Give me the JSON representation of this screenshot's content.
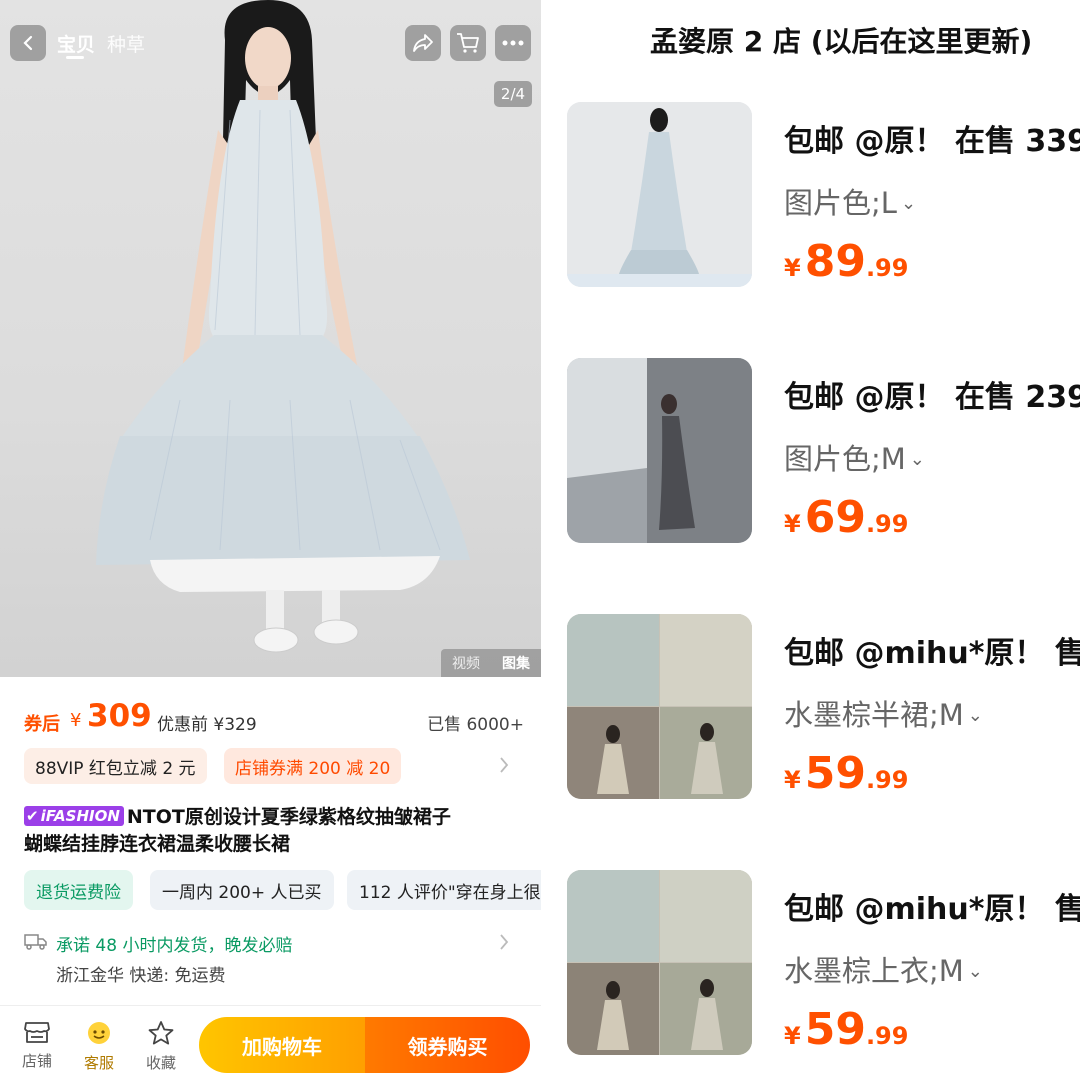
{
  "product_page": {
    "top_tabs": [
      "宝贝",
      "种草"
    ],
    "page_indicator": "2/4",
    "media_switch": [
      "视频",
      "图集"
    ],
    "price": {
      "after_label": "券后",
      "currency": "¥",
      "amount": "309",
      "before_label": "优惠前 ¥329",
      "sold": "已售 6000+"
    },
    "promos": {
      "vip": "88VIP 红包立减 2 元",
      "coupon": "店铺券满 200 减 20"
    },
    "badge": "iFASHION",
    "title_line1": "NTOT原创设计夏季绿紫格纹抽皱裙子",
    "title_line2": "蝴蝶结挂脖连衣裙温柔收腰长裙",
    "tags": {
      "return": "退货运费险",
      "bought": "一周内 200+ 人已买",
      "reviews": "112 人评价\"穿在身上很"
    },
    "shipping": {
      "promise": "承诺 48 小时内发货，晚发必赔",
      "origin": "浙江金华  快递:  免运费"
    },
    "bottom_nav": {
      "shop": "店铺",
      "service": "客服",
      "favorite": "收藏"
    },
    "add_to_cart": "加购物车",
    "buy_now": "领券购买",
    "colors": {
      "accent": "#ff5000",
      "green": "#0a9a63",
      "badge_purple": "#9b3fe8"
    }
  },
  "shop_list": {
    "shop_name": "孟婆原 2 店 (以后在这里更新)",
    "items": [
      {
        "title": "包邮 @原！ 在售 339",
        "spec": "图片色;L",
        "currency": "¥",
        "price_int": "89",
        "price_dec": ".99"
      },
      {
        "title": "包邮 @原！ 在售 239",
        "spec": "图片色;M",
        "currency": "¥",
        "price_int": "69",
        "price_dec": ".99"
      },
      {
        "title": "包邮 @mihu*原！ 售",
        "spec": "水墨棕半裙;M",
        "currency": "¥",
        "price_int": "59",
        "price_dec": ".99"
      },
      {
        "title": "包邮 @mihu*原！ 售",
        "spec": "水墨棕上衣;M",
        "currency": "¥",
        "price_int": "59",
        "price_dec": ".99"
      }
    ]
  }
}
